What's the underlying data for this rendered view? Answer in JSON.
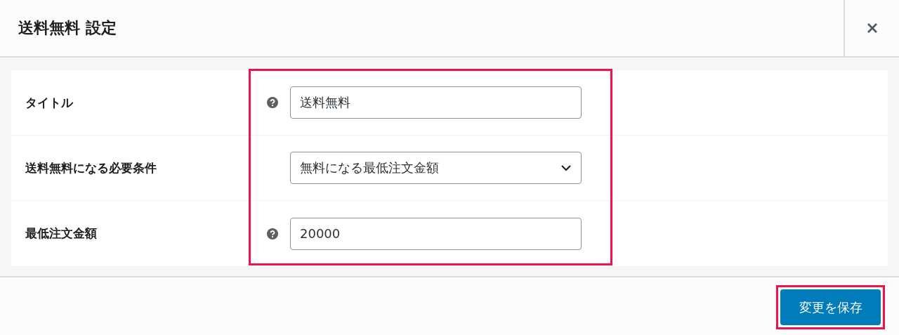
{
  "dialog": {
    "title": "送料無料 設定"
  },
  "fields": [
    {
      "label": "タイトル",
      "kind": "text",
      "help": true,
      "value": "送料無料"
    },
    {
      "label": "送料無料になる必要条件",
      "kind": "select",
      "help": false,
      "value": "無料になる最低注文金額"
    },
    {
      "label": "最低注文金額",
      "kind": "text",
      "help": true,
      "value": "20000"
    }
  ],
  "footer": {
    "save_button": "変更を保存"
  }
}
